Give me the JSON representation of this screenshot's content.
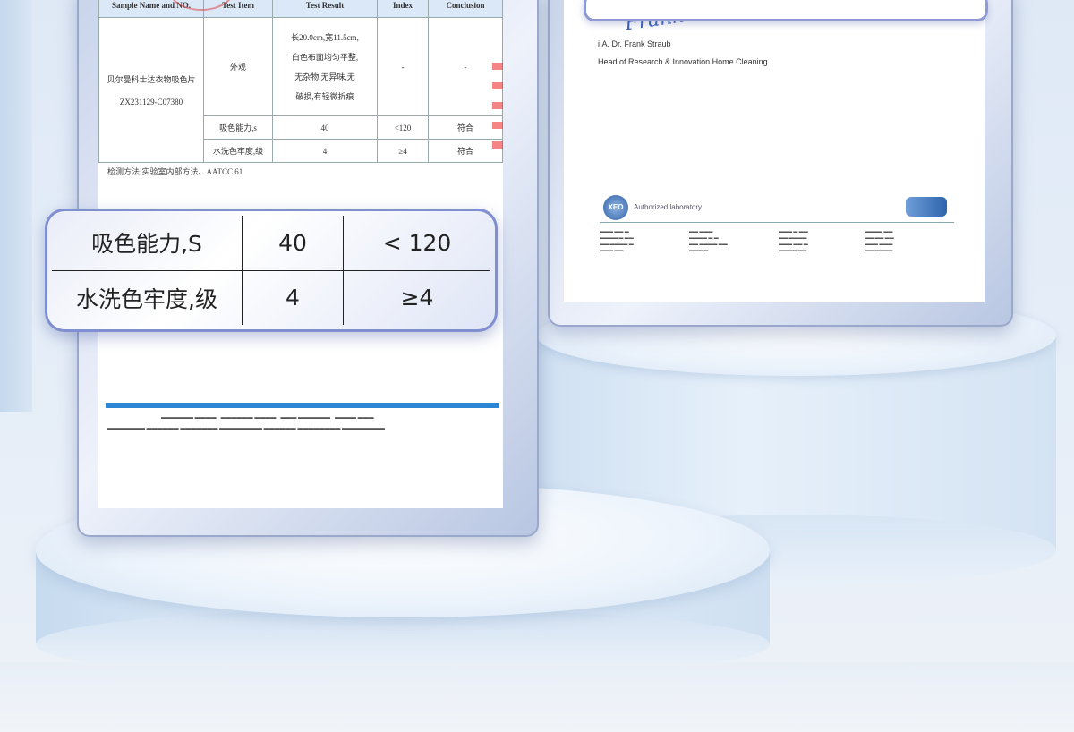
{
  "certificate_left": {
    "headers": [
      "Sample Name and NO.",
      "Test Item",
      "Test Result",
      "Index",
      "Conclusion"
    ],
    "sample_name": "贝尔曼科士达衣物吸色片",
    "sample_no": "ZX231129-C07380",
    "row_appearance": {
      "item": "外观",
      "result_lines": [
        "长20.0cm,宽11.5cm,",
        "白色布面均匀平整,",
        "无杂物,无异味,无",
        "破损,有轻微折痕"
      ],
      "index": "-",
      "conclusion": "-"
    },
    "row_absorb": {
      "item": "吸色能力,s",
      "result": "40",
      "index": "<120",
      "conclusion": "符合"
    },
    "row_fastness": {
      "item": "水洗色牢度,级",
      "result": "4",
      "index": "≥4",
      "conclusion": "符合"
    },
    "method": "检测方法:实验室内部方法、AATCC 61"
  },
  "callout": {
    "row1": {
      "label": "吸色能力,S",
      "value": "40",
      "index": "< 120"
    },
    "row2": {
      "label": "水洗色牢度,级",
      "value": "4",
      "index": "≥4"
    }
  },
  "certificate_right": {
    "signature": "Frank",
    "signer": "i.A. Dr. Frank Straub",
    "title": "Head of Research & Innovation Home Cleaning",
    "logo_text": "XEO",
    "accreditation": "Authorized laboratory"
  }
}
